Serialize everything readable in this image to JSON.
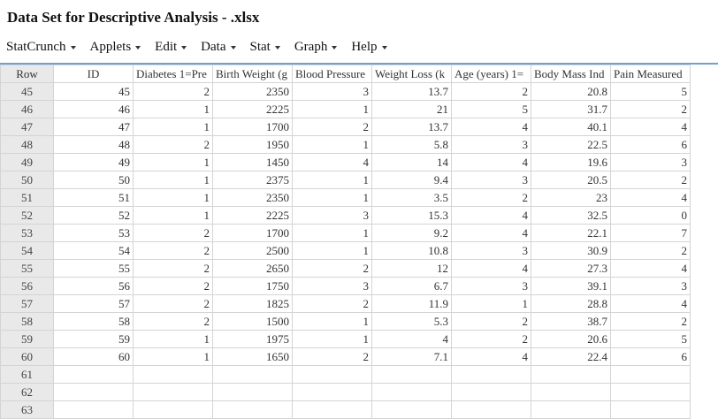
{
  "window": {
    "title": "Data Set for Descriptive Analysis - .xlsx"
  },
  "menu": [
    "StatCrunch",
    "Applets",
    "Edit",
    "Data",
    "Stat",
    "Graph",
    "Help"
  ],
  "grid": {
    "row_header": "Row",
    "columns": [
      "ID",
      "Diabetes 1=Pre",
      "Birth Weight (g",
      "Blood Pressure",
      "Weight Loss (k",
      "Age (years) 1=",
      "Body Mass Ind",
      "Pain Measured"
    ],
    "rows": [
      {
        "n": "45",
        "cells": [
          "45",
          "2",
          "2350",
          "3",
          "13.7",
          "2",
          "20.8",
          "5"
        ]
      },
      {
        "n": "46",
        "cells": [
          "46",
          "1",
          "2225",
          "1",
          "21",
          "5",
          "31.7",
          "2"
        ]
      },
      {
        "n": "47",
        "cells": [
          "47",
          "1",
          "1700",
          "2",
          "13.7",
          "4",
          "40.1",
          "4"
        ]
      },
      {
        "n": "48",
        "cells": [
          "48",
          "2",
          "1950",
          "1",
          "5.8",
          "3",
          "22.5",
          "6"
        ]
      },
      {
        "n": "49",
        "cells": [
          "49",
          "1",
          "1450",
          "4",
          "14",
          "4",
          "19.6",
          "3"
        ]
      },
      {
        "n": "50",
        "cells": [
          "50",
          "1",
          "2375",
          "1",
          "9.4",
          "3",
          "20.5",
          "2"
        ]
      },
      {
        "n": "51",
        "cells": [
          "51",
          "1",
          "2350",
          "1",
          "3.5",
          "2",
          "23",
          "4"
        ]
      },
      {
        "n": "52",
        "cells": [
          "52",
          "1",
          "2225",
          "3",
          "15.3",
          "4",
          "32.5",
          "0"
        ]
      },
      {
        "n": "53",
        "cells": [
          "53",
          "2",
          "1700",
          "1",
          "9.2",
          "4",
          "22.1",
          "7"
        ]
      },
      {
        "n": "54",
        "cells": [
          "54",
          "2",
          "2500",
          "1",
          "10.8",
          "3",
          "30.9",
          "2"
        ]
      },
      {
        "n": "55",
        "cells": [
          "55",
          "2",
          "2650",
          "2",
          "12",
          "4",
          "27.3",
          "4"
        ]
      },
      {
        "n": "56",
        "cells": [
          "56",
          "2",
          "1750",
          "3",
          "6.7",
          "3",
          "39.1",
          "3"
        ]
      },
      {
        "n": "57",
        "cells": [
          "57",
          "2",
          "1825",
          "2",
          "11.9",
          "1",
          "28.8",
          "4"
        ]
      },
      {
        "n": "58",
        "cells": [
          "58",
          "2",
          "1500",
          "1",
          "5.3",
          "2",
          "38.7",
          "2"
        ]
      },
      {
        "n": "59",
        "cells": [
          "59",
          "1",
          "1975",
          "1",
          "4",
          "2",
          "20.6",
          "5"
        ]
      },
      {
        "n": "60",
        "cells": [
          "60",
          "1",
          "1650",
          "2",
          "7.1",
          "4",
          "22.4",
          "6"
        ]
      },
      {
        "n": "61",
        "cells": [
          "",
          "",
          "",
          "",
          "",
          "",
          "",
          ""
        ]
      },
      {
        "n": "62",
        "cells": [
          "",
          "",
          "",
          "",
          "",
          "",
          "",
          ""
        ]
      },
      {
        "n": "63",
        "cells": [
          "",
          "",
          "",
          "",
          "",
          "",
          "",
          ""
        ]
      }
    ]
  }
}
